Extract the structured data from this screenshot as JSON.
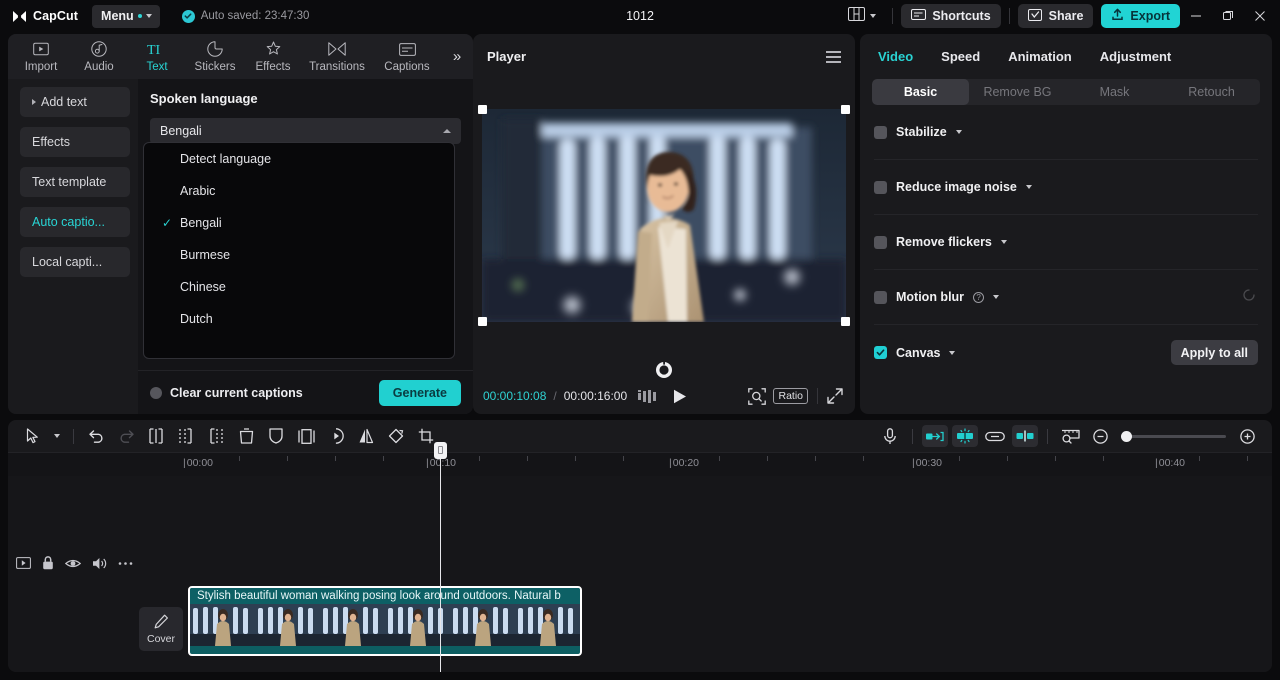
{
  "titlebar": {
    "app_name": "CapCut",
    "menu_label": "Menu",
    "autosave_text": "Auto saved: 23:47:30",
    "project_title": "1012",
    "shortcuts_label": "Shortcuts",
    "share_label": "Share",
    "export_label": "Export",
    "layout_icon": "layout-icon",
    "minimize_icon": "minimize-icon",
    "maximize_icon": "maximize-icon",
    "close_icon": "close-icon"
  },
  "function_tabs": [
    {
      "label": "Import",
      "icon": "import-icon",
      "active": false
    },
    {
      "label": "Audio",
      "icon": "audio-icon",
      "active": false
    },
    {
      "label": "Text",
      "icon": "text-icon",
      "active": true
    },
    {
      "label": "Stickers",
      "icon": "stickers-icon",
      "active": false
    },
    {
      "label": "Effects",
      "icon": "effects-icon",
      "active": false
    },
    {
      "label": "Transitions",
      "icon": "transitions-icon",
      "active": false
    },
    {
      "label": "Captions",
      "icon": "captions-icon",
      "active": false
    }
  ],
  "sidebar": {
    "items": [
      {
        "label": "Add text",
        "accent": false,
        "arrow": true
      },
      {
        "label": "Effects",
        "accent": false,
        "arrow": false
      },
      {
        "label": "Text template",
        "accent": false,
        "arrow": false
      },
      {
        "label": "Auto captio...",
        "accent": true,
        "arrow": false
      },
      {
        "label": "Local capti...",
        "accent": false,
        "arrow": false
      }
    ]
  },
  "captions_pane": {
    "heading": "Spoken language",
    "selected_language": "Bengali",
    "dropdown_open": true,
    "options": [
      {
        "label": "Detect language",
        "selected": false
      },
      {
        "label": "Arabic",
        "selected": false
      },
      {
        "label": "Bengali",
        "selected": true
      },
      {
        "label": "Burmese",
        "selected": false
      },
      {
        "label": "Chinese",
        "selected": false
      },
      {
        "label": "Dutch",
        "selected": false
      }
    ],
    "clear_captions_label": "Clear current captions",
    "clear_captions_checked": false,
    "generate_label": "Generate"
  },
  "player": {
    "title": "Player",
    "menu_icon": "hamburger-icon",
    "current_time": "00:00:10:08",
    "time_separator": "/",
    "total_time": "00:00:16:00",
    "quality_icon": "quality-icon",
    "play_icon": "play-icon",
    "magnifier_icon": "magnifier-icon",
    "ratio_label": "Ratio",
    "fullscreen_icon": "fullscreen-icon",
    "reset_icon": "reset-transform-icon"
  },
  "attributes": {
    "tabs": [
      {
        "label": "Video",
        "active": true
      },
      {
        "label": "Speed",
        "active": false
      },
      {
        "label": "Animation",
        "active": false
      },
      {
        "label": "Adjustment",
        "active": false
      }
    ],
    "segments": [
      {
        "label": "Basic",
        "active": true
      },
      {
        "label": "Remove BG",
        "active": false
      },
      {
        "label": "Mask",
        "active": false
      },
      {
        "label": "Retouch",
        "active": false
      }
    ],
    "rows": [
      {
        "label": "Stabilize",
        "checked": false,
        "has_caret": true,
        "has_help": false
      },
      {
        "label": "Reduce image noise",
        "checked": false,
        "has_caret": true,
        "has_help": false
      },
      {
        "label": "Remove flickers",
        "checked": false,
        "has_caret": true,
        "has_help": false
      },
      {
        "label": "Motion blur",
        "checked": false,
        "has_caret": true,
        "has_help": true
      },
      {
        "label": "Canvas",
        "checked": true,
        "has_caret": true,
        "has_help": false
      }
    ],
    "apply_to_all_label": "Apply to all"
  },
  "timeline": {
    "tools_left": [
      "select-icon",
      "chevron-down-icon",
      "undo-icon",
      "redo-icon",
      "split-icon",
      "trim-left-icon",
      "trim-right-icon",
      "delete-icon",
      "shield-icon",
      "freeze-frame-icon",
      "speed-icon",
      "mirror-icon",
      "rotate-icon",
      "crop-icon"
    ],
    "tools_right": [
      "microphone-icon",
      "auto-fill-icon",
      "auto-cut-icon",
      "link-icon",
      "align-icon",
      "preview-icon",
      "zoom-out-icon",
      "zoom-in-icon"
    ],
    "ruler_labels": [
      "00:00",
      "00:10",
      "00:20",
      "00:30",
      "00:40"
    ],
    "track_controls": [
      "video-track-icon",
      "lock-icon",
      "eye-icon",
      "volume-icon",
      "more-icon"
    ],
    "cover_label": "Cover",
    "clip_caption": "Stylish beautiful woman walking posing look around outdoors. Natural b",
    "playhead_time": "00:10"
  }
}
